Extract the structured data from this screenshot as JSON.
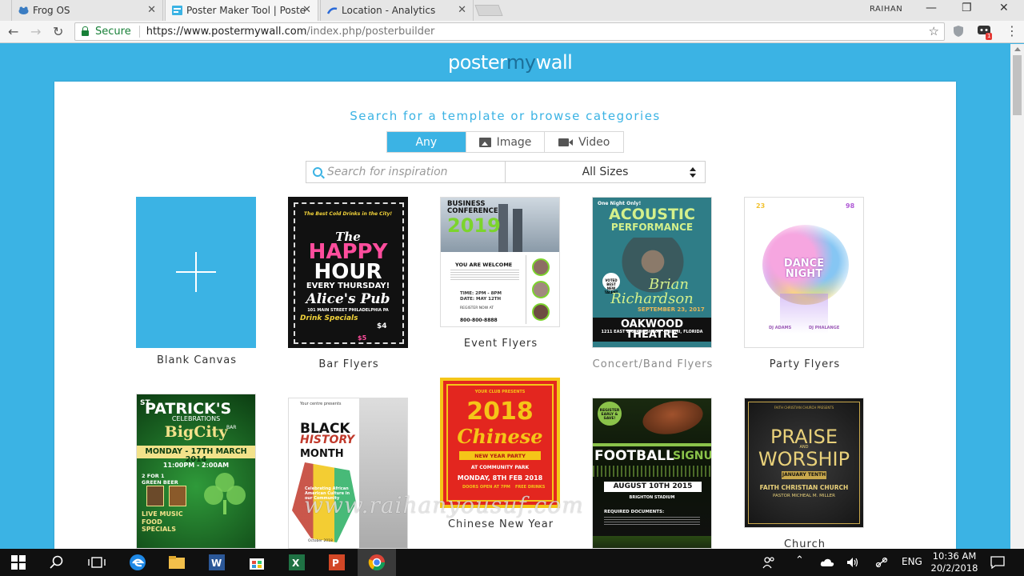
{
  "browser": {
    "tabs": [
      {
        "title": "Frog OS",
        "favicon": "frog-icon"
      },
      {
        "title": "Poster Maker Tool | Poste",
        "favicon": "postermywall-icon"
      },
      {
        "title": "Location - Analytics",
        "favicon": "analytics-icon"
      }
    ],
    "user": "RAIHAN",
    "secure_label": "Secure",
    "url_host": "https://www.postermywall.com",
    "url_path": "/index.php/posterbuilder",
    "extension_badge": "1"
  },
  "page": {
    "logo_part1": "poster",
    "logo_part2": "my",
    "logo_part3": "wall",
    "search_title": "Search for a template or browse categories",
    "filter_tabs": [
      {
        "label": "Any"
      },
      {
        "label": "Image"
      },
      {
        "label": "Video"
      }
    ],
    "search_placeholder": "Search for inspiration",
    "size_selected": "All Sizes",
    "templates": [
      {
        "label": "Blank Canvas"
      },
      {
        "label": "Bar Flyers"
      },
      {
        "label": "Event Flyers"
      },
      {
        "label": "Concert/Band Flyers"
      },
      {
        "label": "Party Flyers"
      },
      {
        "label": "Chinese New Year"
      },
      {
        "label": "Church"
      }
    ],
    "posters": {
      "bar": {
        "line1": "The Best Cold Drinks in the City!",
        "line2": "The",
        "line3": "HAPPY",
        "line4": "HOUR",
        "line5": "EVERY THURSDAY!",
        "line6": "Alice's Pub",
        "line7": "101 MAIN STREET PHILADELPHIA PA",
        "line8": "Drink Specials",
        "line9": "$4",
        "line10": "$5"
      },
      "event": {
        "line1": "BUSINESS",
        "line2": "CONFERENCE",
        "line3": "2019",
        "line4": "YOU ARE WELCOME",
        "line5": "TIME: 2PM - 8PM",
        "line6": "DATE: MAY 12TH",
        "line7": "REGISTER NOW AT",
        "line8": "800-800-8888"
      },
      "concert": {
        "line1": "One Night Only!",
        "line2": "ACOUSTIC",
        "line3": "PERFORMANCE",
        "line4": "Brian",
        "line5": "Richardson",
        "line6": "SEPTEMBER 23, 2017",
        "line7": "OAKWOOD THEATRE",
        "line8": "1211 EAST BANK HIGHWAY - MIAMI, FLORIDA",
        "line9": "VOTED BEST NEW TALENT"
      },
      "party": {
        "line1": "DANCE",
        "line2": "NIGHT",
        "line3": "DJ ADAMS",
        "line4": "DJ PHALANGE",
        "line5": "23",
        "line6": "98"
      },
      "patrick": {
        "line1": "ST.",
        "line2": "PATRICK'S",
        "line3": "CELEBRATIONS",
        "line4": "BigCity",
        "line5": "BAR",
        "line6": "MONDAY - 17TH MARCH 2014",
        "line7": "11:00PM - 2:00AM",
        "line8": "2 FOR 1",
        "line9": "GREEN BEER",
        "line10": "LIVE MUSIC",
        "line11": "FOOD",
        "line12": "SPECIALS"
      },
      "history": {
        "line1": "Your centre presents",
        "line2": "BLACK",
        "line3": "HISTORY",
        "line4": "MONTH",
        "line5": "Celebrating African American Culture in our Community",
        "line6": "October 2018"
      },
      "chinese": {
        "line1": "YOUR CLUB PRESENTS",
        "line2": "2018",
        "line3": "Chinese",
        "line4": "NEW YEAR PARTY",
        "line5": "AT COMMUNITY PARK",
        "line6": "MONDAY, 8TH FEB 2018",
        "line7": "DOORS OPEN AT 7PM",
        "line8": "FREE DRINKS"
      },
      "football": {
        "line1": "REGISTER EARLY & SAVE!",
        "line2": "FOOTBALL",
        "line3": "SIGNUP",
        "line4": "AUGUST 10TH 2015",
        "line5": "BRIGHTON STADIUM",
        "line6": "REQUIRED DOCUMENTS:"
      },
      "church": {
        "line1": "FAITH CHRISTIAN CHURCH PRESENTS",
        "line2": "PRAISE",
        "line3": "AND",
        "line4": "WORSHIP",
        "line5": "JANUARY TENTH",
        "line6": "FAITH CHRISTIAN CHURCH",
        "line7": "PASTOR MICHEAL M. MILLER"
      }
    },
    "watermark": "www.raihanyousuf.com"
  },
  "taskbar": {
    "language": "ENG",
    "time": "10:36 AM",
    "date": "20/2/2018"
  },
  "colors": {
    "brand": "#3bb3e4",
    "secure_green": "#188038"
  }
}
